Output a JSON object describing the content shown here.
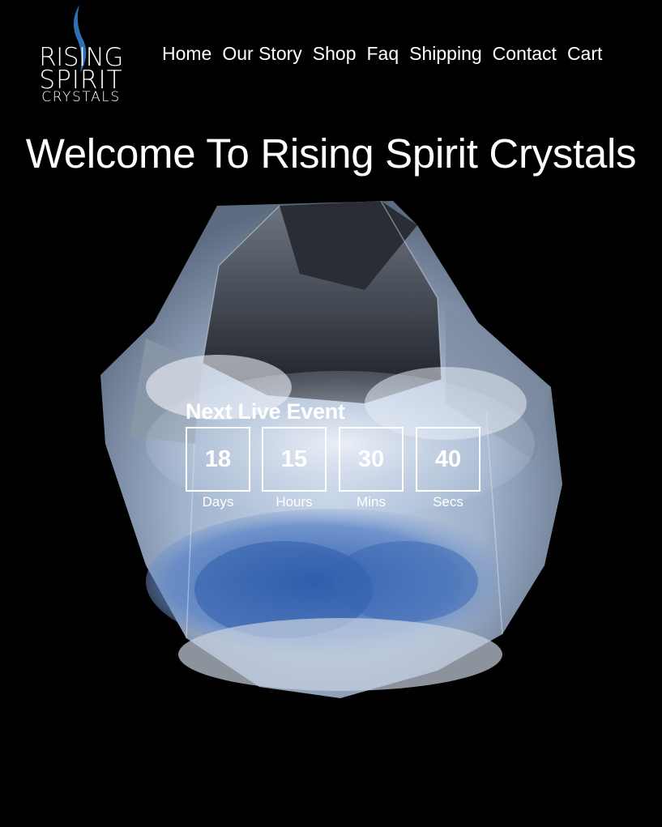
{
  "brand": {
    "logo_line1": "RISING",
    "logo_line2": "SPIRIT",
    "logo_line3": "CRYSTALS"
  },
  "nav": {
    "items": [
      {
        "label": "Home"
      },
      {
        "label": "Our Story"
      },
      {
        "label": "Shop"
      },
      {
        "label": "Faq"
      },
      {
        "label": "Shipping"
      },
      {
        "label": "Contact"
      },
      {
        "label": "Cart"
      }
    ]
  },
  "hero": {
    "title": "Welcome To Rising Spirit Crystals"
  },
  "countdown": {
    "heading": "Next Live Event",
    "units": [
      {
        "value": "18",
        "label": "Days"
      },
      {
        "value": "15",
        "label": "Hours"
      },
      {
        "value": "30",
        "label": "Mins"
      },
      {
        "value": "40",
        "label": "Secs"
      }
    ]
  },
  "colors": {
    "background": "#000000",
    "text": "#ffffff",
    "logo_flame": "#2f6fb5",
    "crystal_blue": "#3e6db8"
  }
}
